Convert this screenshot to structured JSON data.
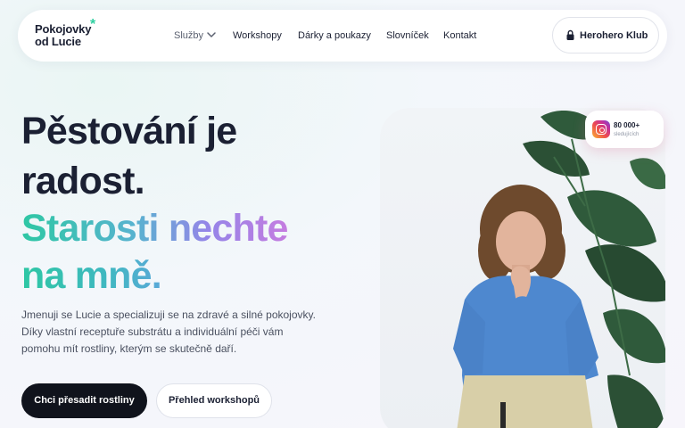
{
  "brand": {
    "line1": "Pokojovky",
    "line2": "od Lucie",
    "star": "*",
    "accent_color": "#2ecfa0"
  },
  "nav": {
    "items": [
      {
        "label": "Služby",
        "has_dropdown": true
      },
      {
        "label": "Workshopy"
      },
      {
        "label": "Dárky a poukazy"
      },
      {
        "label": "Slovníček"
      },
      {
        "label": "Kontakt"
      }
    ],
    "club_button": {
      "label": "Herohero Klub",
      "icon": "lock-icon"
    }
  },
  "hero": {
    "line1": "Pěstování je",
    "line2": "radost.",
    "line3": "Starosti nechte",
    "line4": "na mně.",
    "intro": "Jmenuji se Lucie a specializuji se na zdravé a silné pokojovky. Díky vlastní receptuře substrátu a individuální péči vám pomohu mít rostliny, kterým se skutečně daří.",
    "primary_button": "Chci přesadit rostliny",
    "secondary_button": "Přehled workshopů"
  },
  "instagram": {
    "count": "80 000+",
    "label": "sledujících",
    "icon": "instagram-icon"
  },
  "colors": {
    "text_dark": "#1b2033",
    "button_dark": "#10131c",
    "gradient_start": "#2ec7a4",
    "gradient_end": "#c57ce0"
  }
}
